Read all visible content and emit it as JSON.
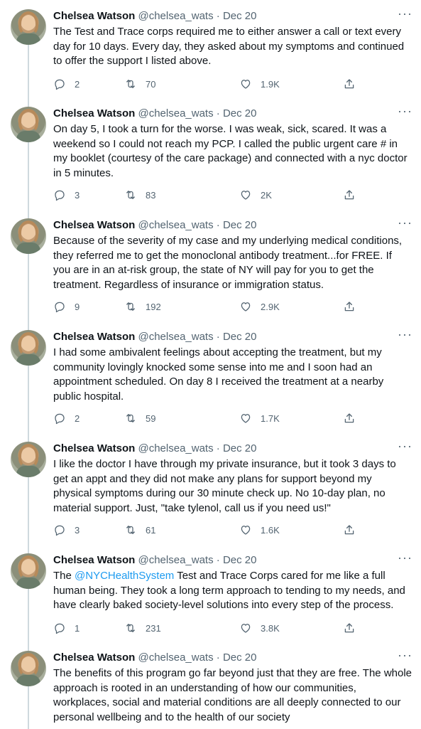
{
  "tweets": [
    {
      "name": "Chelsea Watson",
      "handle": "@chelsea_wats",
      "dot": "·",
      "date": "Dec 20",
      "text": "The Test and Trace corps required me to either answer a call or text every day for 10 days. Every day, they asked about my symptoms and continued to offer the support I listed above.",
      "replies": "2",
      "retweets": "70",
      "likes": "1.9K"
    },
    {
      "name": "Chelsea Watson",
      "handle": "@chelsea_wats",
      "dot": "·",
      "date": "Dec 20",
      "text": "On day 5, I took a turn for the worse. I was weak, sick, scared. It was a weekend so I could not reach my PCP. I called the public urgent care # in my booklet (courtesy of the care package) and connected with a nyc doctor in 5 minutes.",
      "replies": "3",
      "retweets": "83",
      "likes": "2K"
    },
    {
      "name": "Chelsea Watson",
      "handle": "@chelsea_wats",
      "dot": "·",
      "date": "Dec 20",
      "text": "Because of the severity of my case and my underlying medical conditions, they referred me to get the monoclonal antibody treatment...for FREE. If you are in an at-risk group, the state of NY will pay for you to get the treatment. Regardless of insurance or immigration status.",
      "replies": "9",
      "retweets": "192",
      "likes": "2.9K"
    },
    {
      "name": "Chelsea Watson",
      "handle": "@chelsea_wats",
      "dot": "·",
      "date": "Dec 20",
      "text": "I had some ambivalent feelings about accepting the treatment, but my community lovingly knocked some sense into me and I soon had an appointment scheduled. On day 8 I received the treatment at a nearby public hospital.",
      "replies": "2",
      "retweets": "59",
      "likes": "1.7K"
    },
    {
      "name": "Chelsea Watson",
      "handle": "@chelsea_wats",
      "dot": "·",
      "date": "Dec 20",
      "text": "I like the doctor I have through my private insurance, but it took 3 days to get an appt and they did not make any plans for support beyond my physical symptoms during our 30 minute check up. No 10-day plan, no material support. Just, \"take tylenol, call us if you need us!\"",
      "replies": "3",
      "retweets": "61",
      "likes": "1.6K"
    },
    {
      "name": "Chelsea Watson",
      "handle": "@chelsea_wats",
      "dot": "·",
      "date": "Dec 20",
      "text_before": "The ",
      "mention": "@NYCHealthSystem",
      "text_after": " Test and Trace Corps cared for me like a full human being. They took a long term approach to tending to my needs, and have clearly baked society-level solutions into every step of the process.",
      "replies": "1",
      "retweets": "231",
      "likes": "3.8K"
    },
    {
      "name": "Chelsea Watson",
      "handle": "@chelsea_wats",
      "dot": "·",
      "date": "Dec 20",
      "text": "The benefits of this program go far beyond just that they are free. The whole approach is rooted in an understanding of how our communities, workplaces, social and material conditions are all deeply connected to our personal wellbeing and to the health of our society"
    }
  ],
  "more_glyph": "···",
  "icons": {
    "reply": "reply-icon",
    "retweet": "retweet-icon",
    "like": "heart-icon",
    "share": "share-icon"
  },
  "colors": {
    "text": "#0f1419",
    "secondary": "#536471",
    "mention": "#1d9bf0",
    "thread_line": "#cfd9de"
  }
}
